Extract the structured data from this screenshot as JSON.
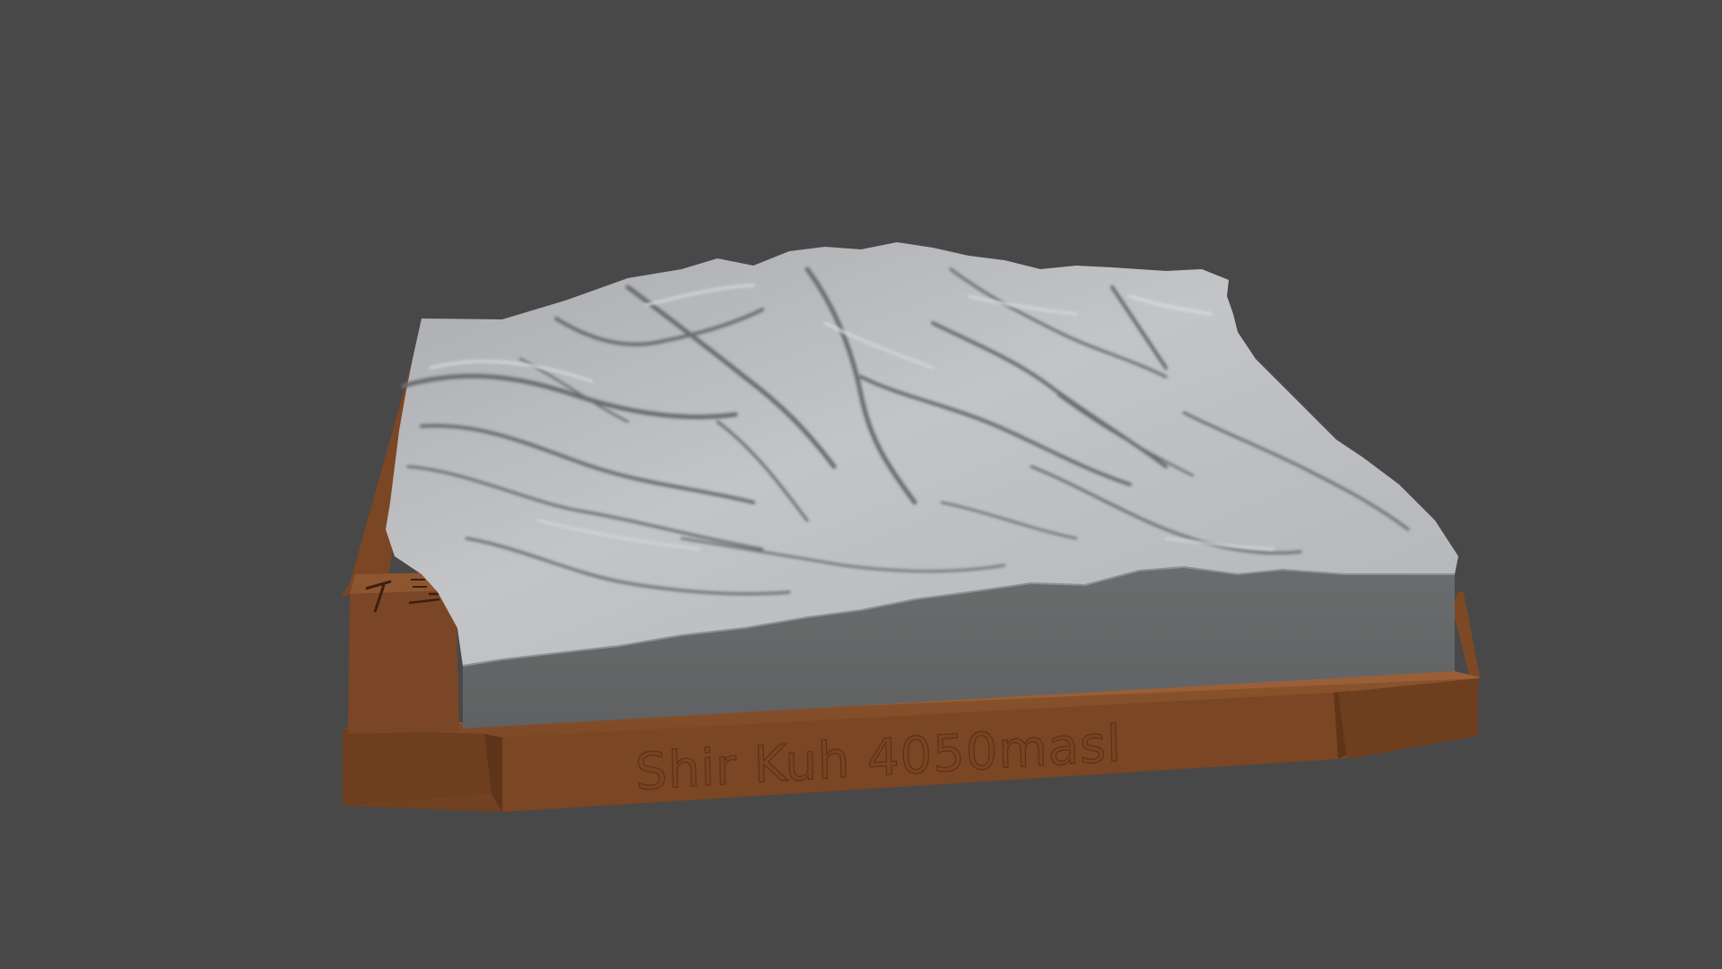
{
  "viewport": {
    "background_color": "#484848"
  },
  "model": {
    "base_label": "Shir Kuh 4050masl",
    "colors": {
      "base_front": "#7d4a27",
      "base_front_dark": "#6a3d1f",
      "base_side": "#8a5530",
      "base_rim": "#a0643a",
      "terrain_light": "#b8babd",
      "terrain_mid": "#9a9c9f",
      "terrain_shadow": "#5e6063",
      "terrain_wall": "#636566"
    },
    "corner_block_icons": [
      "hammer-icon",
      "north-arrow-icon",
      "scale-bar-icon"
    ]
  }
}
